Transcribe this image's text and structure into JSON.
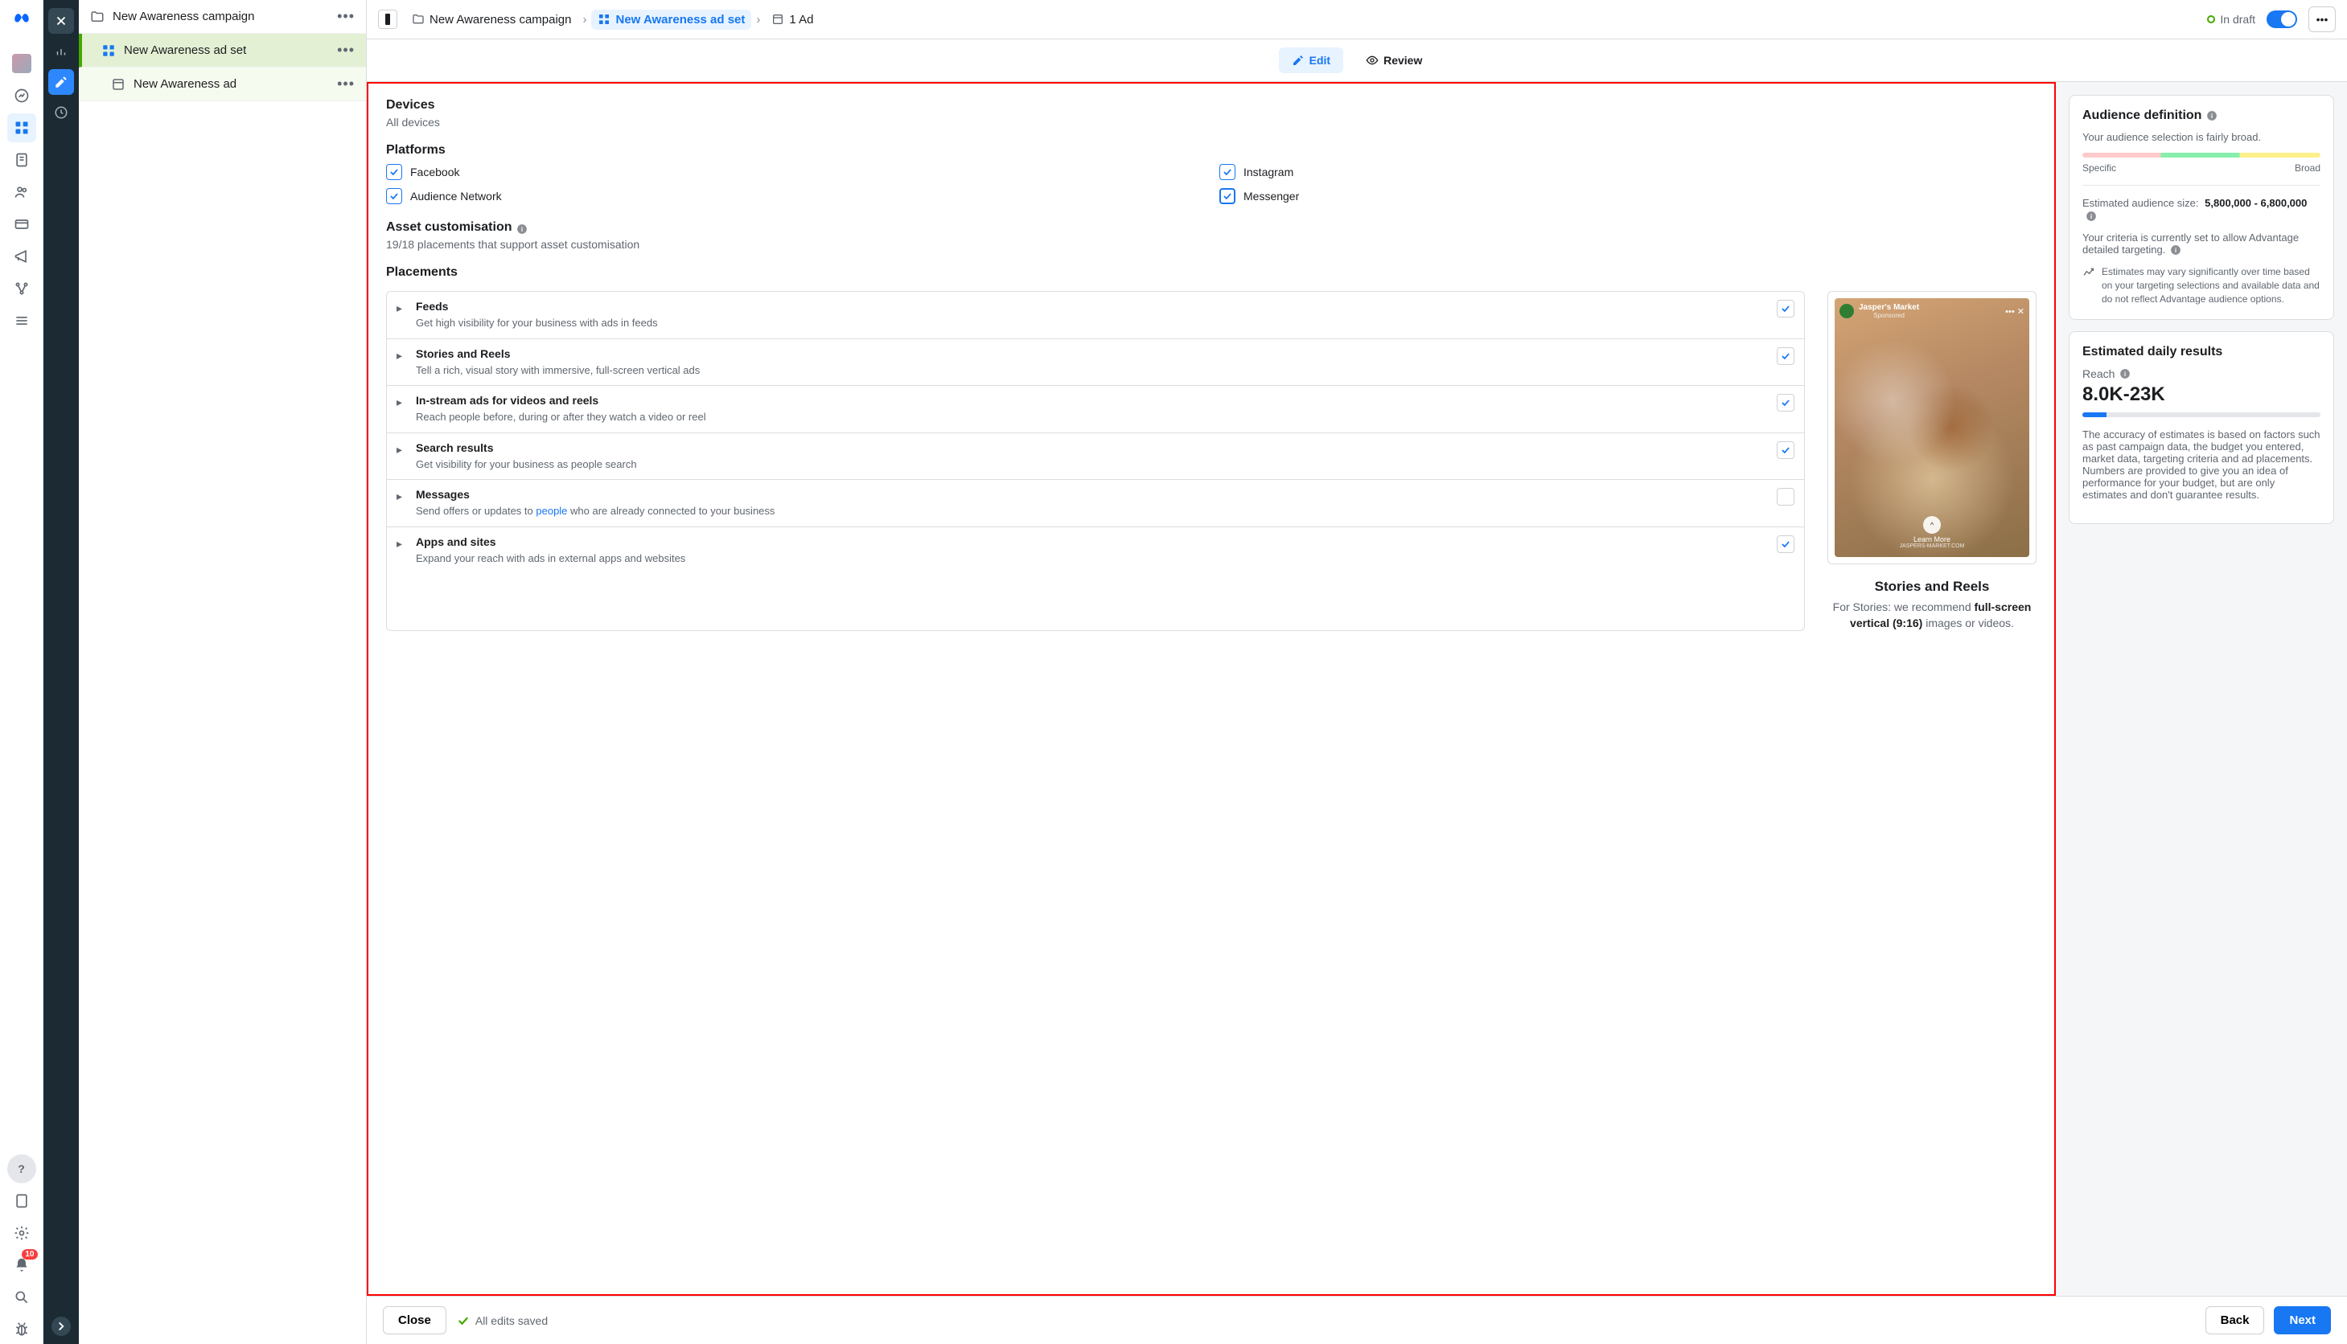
{
  "rail": {
    "notif_count": "10"
  },
  "tree": {
    "campaign": "New Awareness campaign",
    "adset": "New Awareness ad set",
    "ad": "New Awareness ad"
  },
  "topbar": {
    "bc1": "New Awareness campaign",
    "bc2": "New Awareness ad set",
    "bc3": "1 Ad",
    "draft": "In draft"
  },
  "editbar": {
    "edit": "Edit",
    "review": "Review"
  },
  "devices": {
    "title": "Devices",
    "value": "All devices"
  },
  "platforms": {
    "title": "Platforms",
    "items": [
      "Facebook",
      "Instagram",
      "Audience Network",
      "Messenger"
    ]
  },
  "asset": {
    "title": "Asset customisation",
    "sub": "19/18 placements that support asset customisation"
  },
  "placements": {
    "title": "Placements",
    "list": [
      {
        "title": "Feeds",
        "desc": "Get high visibility for your business with ads in feeds",
        "on": true
      },
      {
        "title": "Stories and Reels",
        "desc": "Tell a rich, visual story with immersive, full-screen vertical ads",
        "on": true
      },
      {
        "title": "In-stream ads for videos and reels",
        "desc": "Reach people before, during or after they watch a video or reel",
        "on": true
      },
      {
        "title": "Search results",
        "desc": "Get visibility for your business as people search",
        "on": true
      },
      {
        "title": "Messages",
        "desc_pre": "Send offers or updates to ",
        "link": "people",
        "desc_post": " who are already connected to your business",
        "on": false
      },
      {
        "title": "Apps and sites",
        "desc": "Expand your reach with ads in external apps and websites",
        "on": true
      }
    ]
  },
  "preview": {
    "brand": "Jasper's Market",
    "sponsored": "Sponsored",
    "learn": "Learn More",
    "site": "JASPERS-MARKET.COM",
    "title": "Stories and Reels",
    "text_pre": "For Stories: we recommend ",
    "text_bold": "full-screen vertical (9:16)",
    "text_post": " images or videos."
  },
  "audience": {
    "title": "Audience definition",
    "broad_note": "Your audience selection is fairly broad.",
    "specific": "Specific",
    "broad": "Broad",
    "size_label": "Estimated audience size:",
    "size_value": "5,800,000 - 6,800,000",
    "advantage": "Your criteria is currently set to allow Advantage detailed targeting.",
    "estimate_note": "Estimates may vary significantly over time based on your targeting selections and available data and do not reflect Advantage audience options."
  },
  "daily": {
    "title": "Estimated daily results",
    "reach_label": "Reach",
    "reach_value": "8.0K-23K",
    "note": "The accuracy of estimates is based on factors such as past campaign data, the budget you entered, market data, targeting criteria and ad placements. Numbers are provided to give you an idea of performance for your budget, but are only estimates and don't guarantee results."
  },
  "footer": {
    "close": "Close",
    "saved": "All edits saved",
    "back": "Back",
    "next": "Next"
  }
}
